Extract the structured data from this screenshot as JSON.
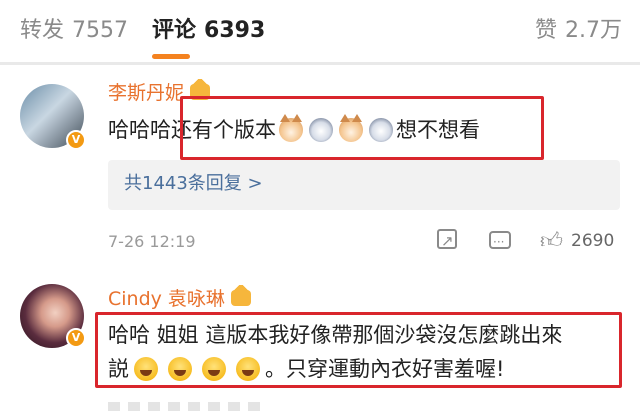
{
  "tabs": {
    "repost": {
      "label": "转发",
      "count": "7557"
    },
    "comments": {
      "label": "评论",
      "count": "6393"
    },
    "likes": {
      "label": "赞",
      "count": "2.7万"
    }
  },
  "colors": {
    "accent": "#f4821f",
    "name": "#e8722e",
    "highlight": "#d9262c",
    "link": "#4a6f9c"
  },
  "comments": [
    {
      "user": "李斯丹妮",
      "text_before": "哈哈哈",
      "text_highlight": "还有个版本",
      "text_after": "想不想看",
      "emojis": [
        "cat-icon",
        "dog-icon",
        "cat-icon",
        "dog-icon"
      ],
      "replies": "共1443条回复 >",
      "time": "7-26 12:19",
      "likes": "2690"
    },
    {
      "user": "Cindy 袁咏琳",
      "line1": "哈哈 姐姐 這版本我好像帶那個沙袋沒怎麼跳出來",
      "line2_prefix": "説",
      "line2_suffix": "。只穿運動內衣好害羞喔!",
      "emojis": [
        "laugh-icon",
        "laugh-icon",
        "laugh-icon",
        "laugh-icon"
      ]
    }
  ]
}
